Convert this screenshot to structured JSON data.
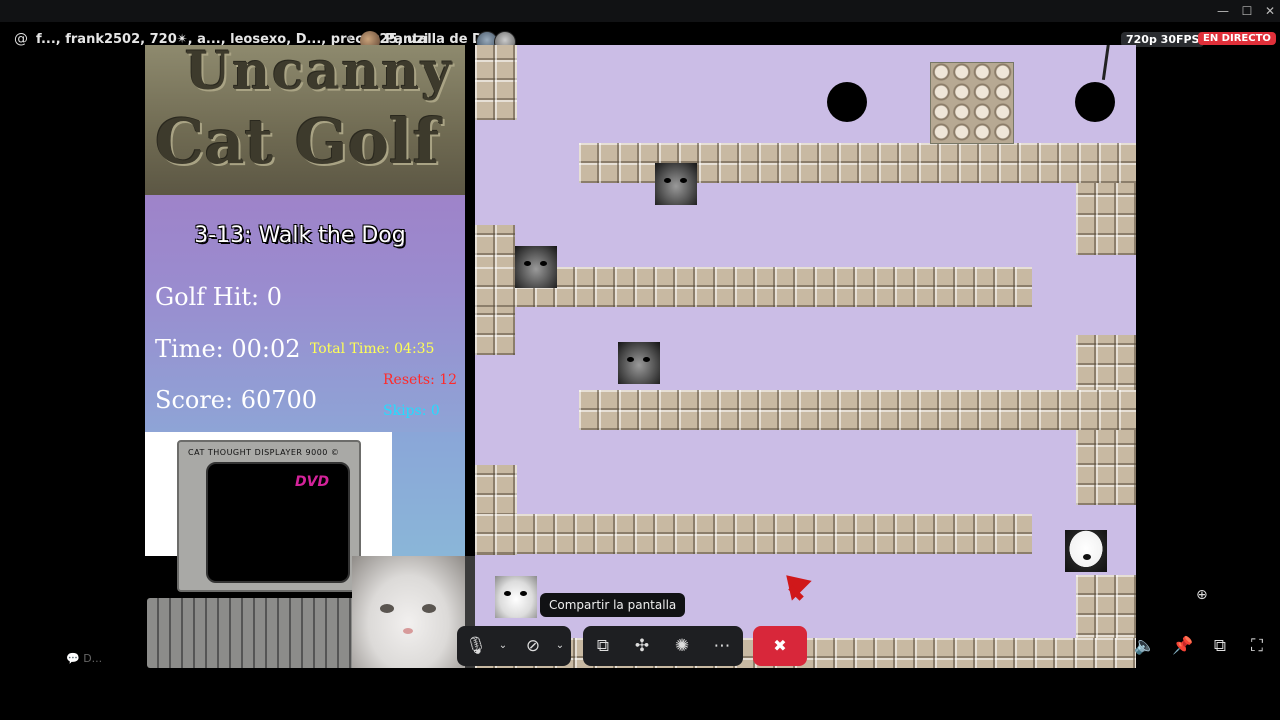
{
  "header": {
    "participants": "f..., frank2502, 720✴, a..., leosexo, D..., precoz25, uzi",
    "sharer": "Pantalla de D...",
    "quality": "720p 30FPS",
    "live": "EN DIRECTO"
  },
  "game": {
    "logo_line1": "Uncanny",
    "logo_line2": "Cat Golf",
    "level": "3-13: Walk the Dog",
    "golf_hit": "Golf Hit: 0",
    "time": "Time: 00:02",
    "score": "Score: 60700",
    "total_time": "Total Time: 04:35",
    "resets": "Resets: 12",
    "skips": "Skips: 0",
    "cat_thought_label": "CAT THOUGHT DISPLAYER 9000 ©",
    "dvd": "DVD"
  },
  "tooltip": "Compartir la pantalla",
  "chat_hint": "D...",
  "icons": {
    "mic": "🎙",
    "camera_off": "⊘",
    "share": "⧉",
    "activities": "✣",
    "soundboard": "✺",
    "more": "⋯",
    "leave": "✖",
    "volume": "🔈",
    "pin": "📌",
    "popout": "⧉",
    "fullscreen": "⛶",
    "zoom": "⊕"
  },
  "colors": {
    "live": "#e0303a",
    "leave": "#d8273a",
    "resets": "#ff2a2a",
    "skips": "#22ddff",
    "total_time": "#ffff55"
  }
}
